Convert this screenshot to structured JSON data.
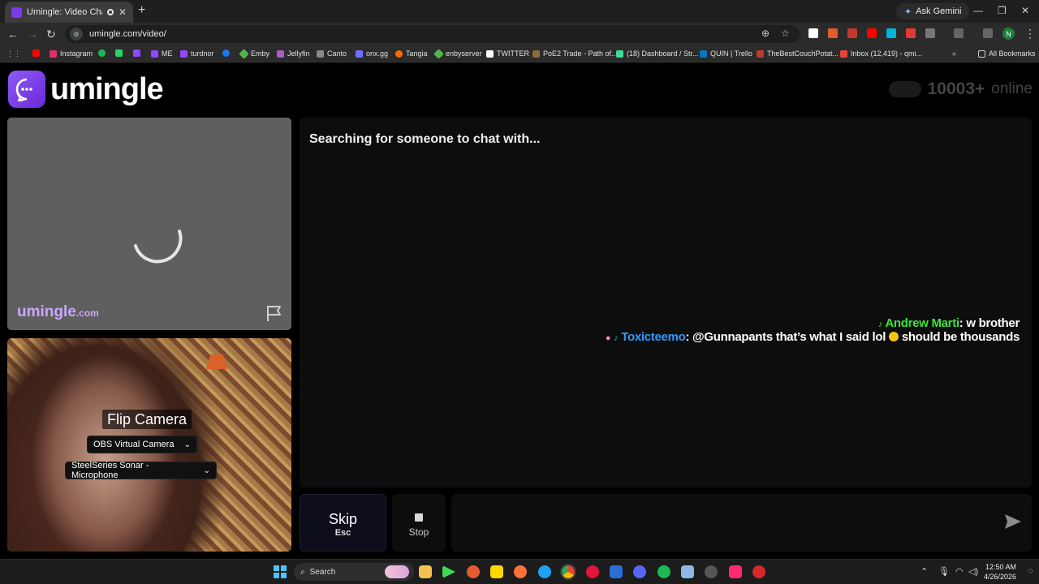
{
  "browser": {
    "tab_title": "Umingle: Video Chat with S",
    "new_tab": "+",
    "tab_close": "✕",
    "ask_gemini": "Ask Gemini",
    "url": "umingle.com/video/",
    "profile_initial": "N",
    "bookmarks": [
      {
        "label": "Instagram",
        "color": "#e1306c"
      },
      {
        "label": "",
        "color": "#1db954"
      },
      {
        "label": "",
        "color": "#25d366"
      },
      {
        "label": "",
        "color": "#9146ff"
      },
      {
        "label": "ME",
        "color": "#9146ff"
      },
      {
        "label": "turdnor",
        "color": "#9146ff"
      },
      {
        "label": "",
        "color": "#1877f2"
      },
      {
        "label": "Emby",
        "color": "#52b54b"
      },
      {
        "label": "Jellyfin",
        "color": "#aa5cc3"
      },
      {
        "label": "Canto",
        "color": "#888888"
      },
      {
        "label": "onx.gg",
        "color": "#6f6fff"
      },
      {
        "label": "Tangia",
        "color": "#ff6a00"
      },
      {
        "label": "enbyserver",
        "color": "#52b54b"
      },
      {
        "label": "TWITTER",
        "color": "#ffffff"
      },
      {
        "label": "PoE2 Trade - Path of...",
        "color": "#8a6d3b"
      },
      {
        "label": "(18) Dashboard / Str...",
        "color": "#3ddc97"
      },
      {
        "label": "QUIN | Trello",
        "color": "#0079bf"
      },
      {
        "label": "TheBestCouchPotat...",
        "color": "#c0392b"
      },
      {
        "label": "Inbox (12,419) - qmi...",
        "color": "#ea4335"
      }
    ],
    "all_bookmarks": "All Bookmarks"
  },
  "page": {
    "logo_text": "umingle",
    "online_count": "10003+",
    "online_label": "online",
    "remote_watermark_main": "umingle",
    "remote_watermark_tld": ".com",
    "flip_camera": "Flip Camera",
    "camera_select": "OBS Virtual Camera",
    "mic_select": "SteelSeries Sonar - Microphone",
    "searching_text": "Searching for someone to chat with...",
    "chat": [
      {
        "name": "Andrew Marti",
        "name_color": "#39e639",
        "text": ": w brother",
        "badge": "♪"
      },
      {
        "name": "Toxicteemo",
        "name_color": "#2f9bff",
        "text": ": @Gunnapants that’s what I said lol",
        "tail": " should be thousands",
        "badge": "♪"
      }
    ],
    "skip_label": "Skip",
    "skip_key": "Esc",
    "stop_label": "Stop"
  },
  "taskbar": {
    "search_label": "Search",
    "time": "12:50 AM",
    "date": "4/26/2026"
  }
}
